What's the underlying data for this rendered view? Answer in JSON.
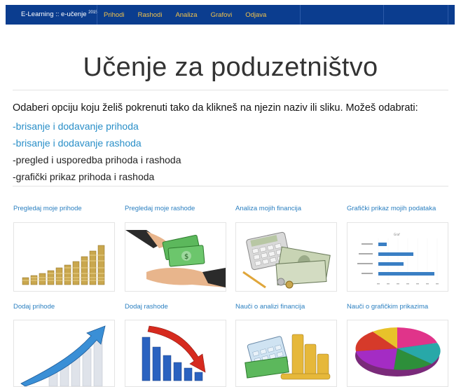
{
  "navbar": {
    "brand": "E-Learning :: e-učenje",
    "brand_sup": "2015",
    "links": [
      "Prihodi",
      "Rashodi",
      "Analiza",
      "Grafovi",
      "Odjava"
    ]
  },
  "page_title": "Učenje za poduzetništvo",
  "intro": "Odaberi opciju koju želiš pokrenuti tako da klikneš na njezin naziv ili sliku. Možeš odabrati:",
  "options": [
    "-brisanje i dodavanje prihoda",
    "-brisanje i dodavanje rashoda",
    "-pregled i usporedba prihoda i rashoda",
    "-grafički prikaz prihoda i rashoda"
  ],
  "cards": [
    {
      "title": "Pregledaj moje prihode",
      "image": "coin-stacks-growth-image"
    },
    {
      "title": "Pregledaj moje rashode",
      "image": "money-handover-image"
    },
    {
      "title": "Analiza mojih financija",
      "image": "calculator-money-image"
    },
    {
      "title": "Grafički prikaz mojih podataka",
      "image": "bar-chart-image"
    },
    {
      "title": "Dodaj prihode",
      "image": "rising-arrow-chart-image"
    },
    {
      "title": "Dodaj rashode",
      "image": "falling-arrow-chart-image"
    },
    {
      "title": "Nauči o analizi financija",
      "image": "calculator-coins-image"
    },
    {
      "title": "Nauči o grafičkim prikazima",
      "image": "pie-chart-image"
    }
  ],
  "colors": {
    "navbar": "#0b3d8f",
    "nav_link": "#f2c24a",
    "link": "#2a8fc8"
  }
}
